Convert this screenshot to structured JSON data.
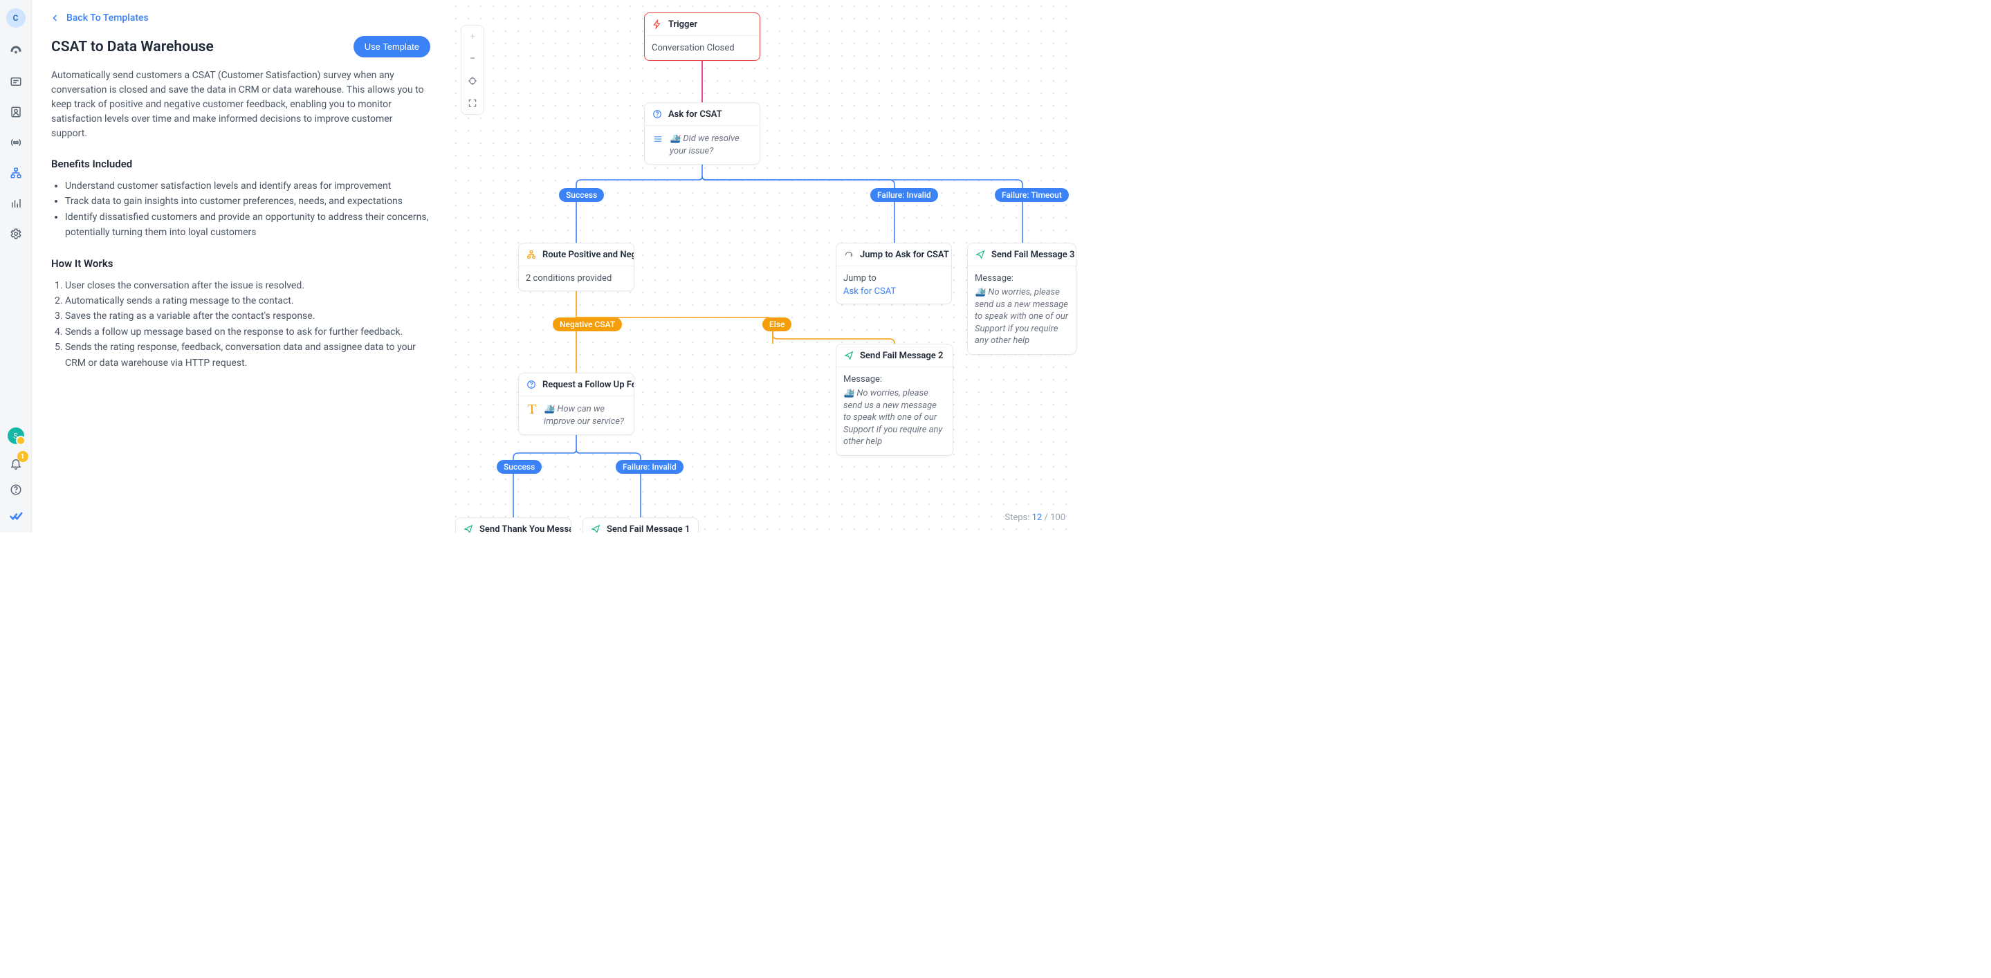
{
  "rail": {
    "workspace_initial": "C",
    "status_initial": "S",
    "notif_count": "1"
  },
  "panel": {
    "back_label": "Back To Templates",
    "title": "CSAT to Data Warehouse",
    "use_button": "Use Template",
    "description": "Automatically send customers a CSAT (Customer Satisfaction) survey when any conversation is closed and save the data in CRM or data warehouse. This allows you to keep track of positive and negative customer feedback, enabling you to monitor satisfaction levels over time and make informed decisions to improve customer support.",
    "benefits_heading": "Benefits Included",
    "benefits": [
      "Understand customer satisfaction levels and identify areas for improvement",
      "Track data to gain insights into customer preferences, needs, and expectations",
      "Identify dissatisfied customers and provide an opportunity to address their concerns, potentially turning them into loyal customers"
    ],
    "how_heading": "How It Works",
    "steps": [
      "User closes the conversation after the issue is resolved.",
      "Automatically sends a rating message to the contact.",
      "Saves the rating as a variable after the contact's response.",
      "Sends a follow up message based on the response to ask for further feedback.",
      "Sends the rating response, feedback, conversation data and assignee data to your CRM or data warehouse via HTTP request."
    ]
  },
  "canvas": {
    "nodes": {
      "trigger": {
        "title": "Trigger",
        "body": "Conversation Closed"
      },
      "ask_csat": {
        "title": "Ask for CSAT",
        "body": "🛳️ Did we resolve your issue?"
      },
      "route": {
        "title": "Route Positive and Nega…",
        "body": "2 conditions provided"
      },
      "jump": {
        "title": "Jump to Ask for CSAT",
        "label": "Jump to",
        "target": "Ask for CSAT"
      },
      "fail3": {
        "title": "Send Fail Message 3",
        "label": "Message:",
        "body": "🛳️ No worries, please send us a new message to speak with one of our Support if you require any other help"
      },
      "fail2": {
        "title": "Send Fail Message 2",
        "label": "Message:",
        "body": "🛳️ No worries, please send us a new message to speak with one of our Support if you require any other help"
      },
      "followup": {
        "title": "Request a Follow Up Fee…",
        "body": "🛳️ How can we improve our service?"
      },
      "thankyou": {
        "title": "Send Thank You Messa…"
      },
      "fail1": {
        "title": "Send Fail Message 1"
      }
    },
    "pills": {
      "success1": "Success",
      "fail_invalid1": "Failure: Invalid",
      "fail_timeout": "Failure: Timeout",
      "neg_csat": "Negative CSAT",
      "else": "Else",
      "success2": "Success",
      "fail_invalid2": "Failure: Invalid"
    },
    "footer": {
      "label": "Steps: ",
      "current": "12",
      "sep": " / ",
      "max": "100"
    }
  }
}
